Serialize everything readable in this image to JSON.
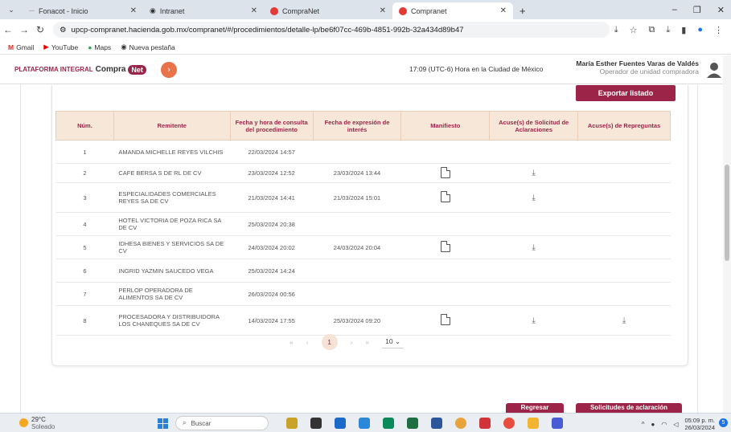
{
  "browser": {
    "tabs": [
      {
        "label": "Fonacot - Inicio",
        "icon": "fonacot-favicon"
      },
      {
        "label": "Intranet",
        "icon": "globe-icon"
      },
      {
        "label": "CompraNet",
        "icon": "compranet-favicon"
      },
      {
        "label": "Compranet",
        "icon": "compranet-favicon",
        "active": true
      }
    ],
    "new_tab": "+",
    "url": "upcp-compranet.hacienda.gob.mx/compranet/#/procedimientos/detalle-lp/be6f07cc-469b-4851-992b-32a434d89b47",
    "bookmarks": [
      "Gmail",
      "YouTube",
      "Maps",
      "Nueva pestaña"
    ]
  },
  "header": {
    "logo_prefix": "PLATAFORMA INTEGRAL",
    "logo_main": "Compra",
    "logo_badge": "Net",
    "clock": "17:09 (UTC-6) Hora en la Ciudad de México",
    "user_name": "María Esther Fuentes Varas de Valdés",
    "user_role": "Operador de unidad compradora"
  },
  "actions": {
    "export": "Exportar listado"
  },
  "table": {
    "headers": [
      "Núm.",
      "Remitente",
      "Fecha y hora de consulta del procedimiento",
      "Fecha de expresión de interés",
      "Manifiesto",
      "Acuse(s) de Solicitud de Aclaraciones",
      "Acuse(s) de Repreguntas"
    ],
    "rows": [
      {
        "num": "1",
        "remitente": "AMANDA MICHELLE REYES VILCHIS",
        "consulta": "22/03/2024 14:57",
        "interes": "",
        "manifiesto": false,
        "aclaraciones": false,
        "repreguntas": false
      },
      {
        "num": "2",
        "remitente": "CAFE BERSA S DE RL DE CV",
        "consulta": "23/03/2024 12:52",
        "interes": "23/03/2024 13:44",
        "manifiesto": true,
        "aclaraciones": true,
        "repreguntas": false
      },
      {
        "num": "3",
        "remitente": "ESPECIALIDADES COMERCIALES REYES SA DE CV",
        "consulta": "21/03/2024 14:41",
        "interes": "21/03/2024 15:01",
        "manifiesto": true,
        "aclaraciones": true,
        "repreguntas": false
      },
      {
        "num": "4",
        "remitente": "HOTEL VICTORIA DE POZA RICA SA DE CV",
        "consulta": "25/03/2024 20:38",
        "interes": "",
        "manifiesto": false,
        "aclaraciones": false,
        "repreguntas": false
      },
      {
        "num": "5",
        "remitente": "IDHESA BIENES Y SERVICIOS SA DE CV",
        "consulta": "24/03/2024 20:02",
        "interes": "24/03/2024 20:04",
        "manifiesto": true,
        "aclaraciones": true,
        "repreguntas": false
      },
      {
        "num": "6",
        "remitente": "INGRID YAZMIN SAUCEDO VEGA",
        "consulta": "25/03/2024 14:24",
        "interes": "",
        "manifiesto": false,
        "aclaraciones": false,
        "repreguntas": false
      },
      {
        "num": "7",
        "remitente": "PERLOP OPERADORA DE ALIMENTOS SA DE CV",
        "consulta": "26/03/2024 00:56",
        "interes": "",
        "manifiesto": false,
        "aclaraciones": false,
        "repreguntas": false
      },
      {
        "num": "8",
        "remitente": "PROCESADORA Y DISTRIBUIDORA LOS CHANEQUES SA DE CV",
        "consulta": "14/03/2024 17:55",
        "interes": "25/03/2024 09:20",
        "manifiesto": true,
        "aclaraciones": true,
        "repreguntas": true
      }
    ]
  },
  "pagination": {
    "first": "«",
    "prev": "‹",
    "current": "1",
    "next": "›",
    "last": "»",
    "page_size": "10"
  },
  "bottom_buttons": {
    "back": "Regresar",
    "request": "Solicitudes de aclaración"
  },
  "taskbar": {
    "temp": "29°C",
    "weather": "Soleado",
    "search": "Buscar",
    "time": "05:09 p. m.",
    "date": "26/03/2024",
    "notifications": "5"
  }
}
